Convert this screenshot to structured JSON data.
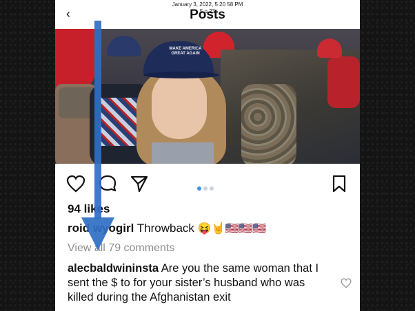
{
  "status": {
    "datetime": "January 3, 2022, 5 20 58 PM",
    "subline": "5 o 23"
  },
  "header": {
    "title": "Posts"
  },
  "post": {
    "likes": "94 likes",
    "username": "roid  wyogirl",
    "caption_text": "Throwback",
    "caption_emojis": "😝🤘🇺🇸🇺🇸🇺🇸",
    "hat_text": "MAKE AMERICA GREAT AGAIN",
    "view_comments": "View all 79 comments",
    "carousel_index": 1,
    "carousel_count": 3
  },
  "comment": {
    "username": "alecbaldwininsta",
    "text": "Are you the same woman that I sent the $ to for your sister’s husband who was killed during the Afghanistan exit"
  },
  "colors": {
    "accent": "#3897f0",
    "overlay_arrow": "#2f6fc4"
  }
}
